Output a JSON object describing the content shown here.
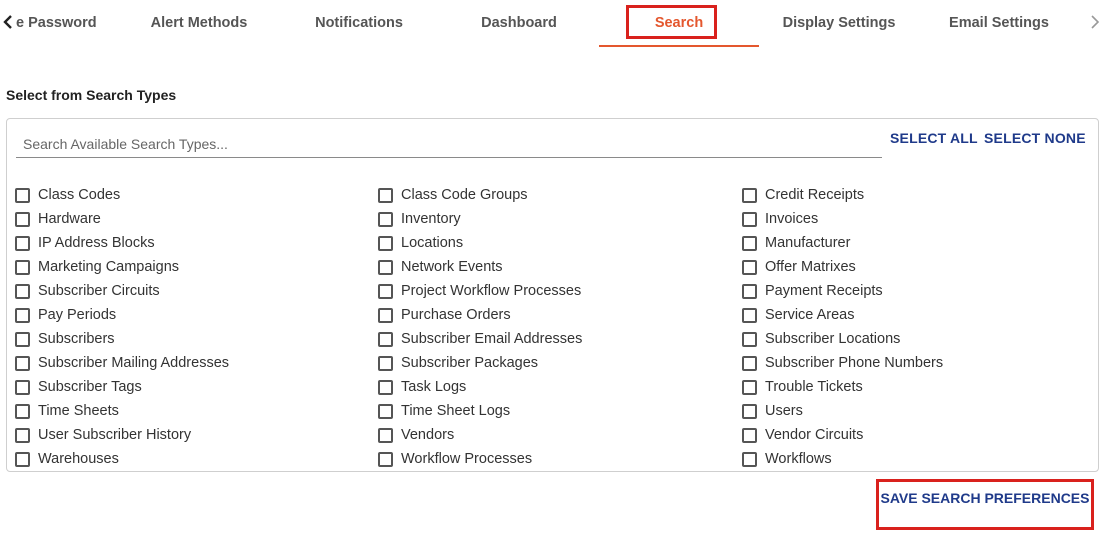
{
  "tabs": {
    "items": [
      {
        "label": "e Password"
      },
      {
        "label": "Alert Methods"
      },
      {
        "label": "Notifications"
      },
      {
        "label": "Dashboard"
      },
      {
        "label": "Search"
      },
      {
        "label": "Display Settings"
      },
      {
        "label": "Email Settings"
      }
    ],
    "active": "Search"
  },
  "section": {
    "title": "Select from Search Types"
  },
  "search": {
    "placeholder": "Search Available Search Types..."
  },
  "actions": {
    "select_all": "SELECT ALL",
    "select_none": "SELECT NONE",
    "save": "SAVE SEARCH PREFERENCES"
  },
  "options": {
    "col1": [
      "Class Codes",
      "Hardware",
      "IP Address Blocks",
      "Marketing Campaigns",
      "Subscriber Circuits",
      "Pay Periods",
      "Subscribers",
      "Subscriber Mailing Addresses",
      "Subscriber Tags",
      "Time Sheets",
      "User Subscriber History",
      "Warehouses"
    ],
    "col2": [
      "Class Code Groups",
      "Inventory",
      "Locations",
      "Network Events",
      "Project Workflow Processes",
      "Purchase Orders",
      "Subscriber Email Addresses",
      "Subscriber Packages",
      "Task Logs",
      "Time Sheet Logs",
      "Vendors",
      "Workflow Processes"
    ],
    "col3": [
      "Credit Receipts",
      "Invoices",
      "Manufacturer",
      "Offer Matrixes",
      "Payment Receipts",
      "Service Areas",
      "Subscriber Locations",
      "Subscriber Phone Numbers",
      "Trouble Tickets",
      "Users",
      "Vendor Circuits",
      "Workflows"
    ]
  },
  "colors": {
    "active_tab": "#e4572e",
    "link": "#1f3a8a",
    "highlight": "#d9211d"
  }
}
